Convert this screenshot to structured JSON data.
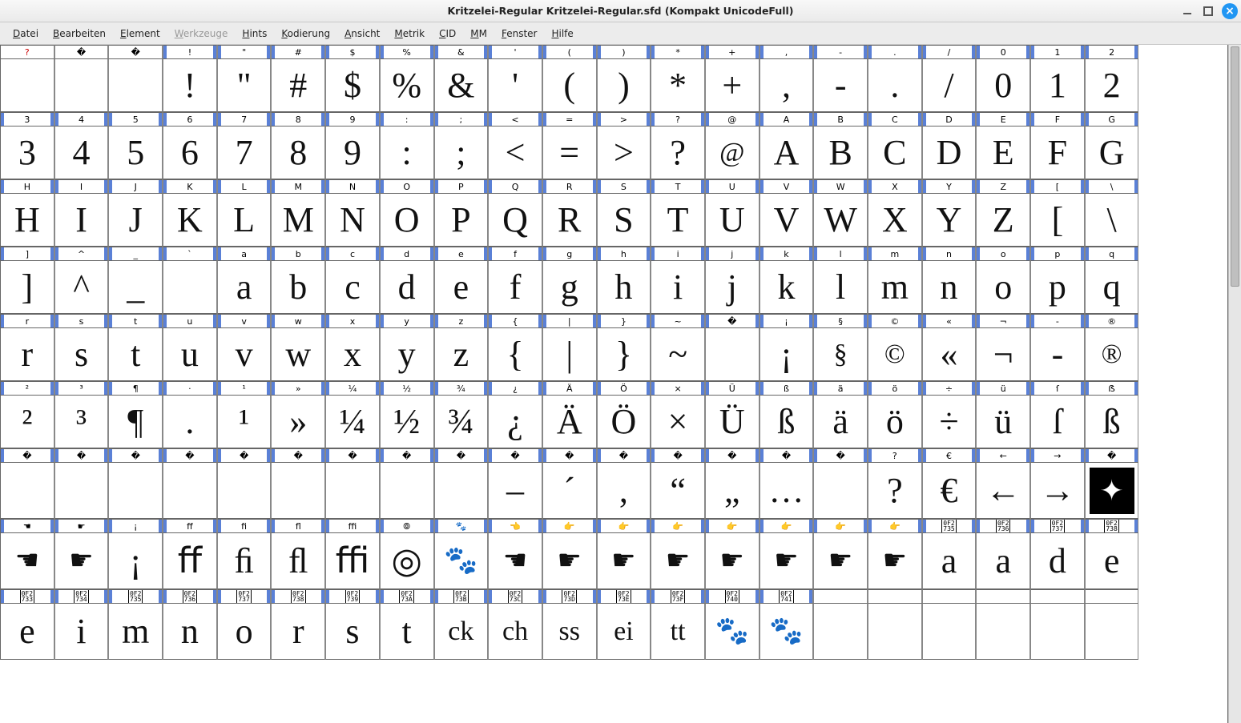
{
  "window": {
    "title": "Kritzelei-Regular  Kritzelei-Regular.sfd (Kompakt UnicodeFull)"
  },
  "menu": [
    {
      "label": "Datei",
      "hot": "D",
      "enabled": true
    },
    {
      "label": "Bearbeiten",
      "hot": "B",
      "enabled": true
    },
    {
      "label": "Element",
      "hot": "E",
      "enabled": true
    },
    {
      "label": "Werkzeuge",
      "hot": "W",
      "enabled": false
    },
    {
      "label": "Hints",
      "hot": "H",
      "enabled": true
    },
    {
      "label": "Kodierung",
      "hot": "K",
      "enabled": true
    },
    {
      "label": "Ansicht",
      "hot": "A",
      "enabled": true
    },
    {
      "label": "Metrik",
      "hot": "M",
      "enabled": true
    },
    {
      "label": "CID",
      "hot": "C",
      "enabled": true
    },
    {
      "label": "MM",
      "hot": "M",
      "enabled": true
    },
    {
      "label": "Fenster",
      "hot": "F",
      "enabled": true
    },
    {
      "label": "Hilfe",
      "hot": "H",
      "enabled": true
    }
  ],
  "rows": [
    {
      "header": [
        "?",
        "�",
        "�",
        "!",
        "\"",
        "#",
        "$",
        "%",
        "&",
        "'",
        "(",
        ")",
        "*",
        "+",
        ",",
        "-",
        ".",
        "/",
        "0",
        "1",
        "2"
      ],
      "flags": [
        "r",
        "",
        "",
        "h",
        "h",
        "h",
        "h",
        "h",
        "h",
        "h",
        "h",
        "h",
        "h",
        "h",
        "h",
        "h",
        "h",
        "h",
        "h",
        "h",
        "h"
      ],
      "glyphs": [
        "",
        "",
        "",
        "!",
        "\"",
        "#",
        "$",
        "%",
        "&",
        "'",
        "(",
        ")",
        "*",
        "+",
        ",",
        "-",
        ".",
        "/",
        "0",
        "1",
        "2"
      ]
    },
    {
      "header": [
        "3",
        "4",
        "5",
        "6",
        "7",
        "8",
        "9",
        ":",
        ";",
        "<",
        "=",
        ">",
        "?",
        "@",
        "A",
        "B",
        "C",
        "D",
        "E",
        "F",
        "G"
      ],
      "flags": [
        "h",
        "h",
        "h",
        "h",
        "h",
        "h",
        "h",
        "h",
        "h",
        "h",
        "h",
        "h",
        "h",
        "h",
        "h",
        "h",
        "h",
        "h",
        "h",
        "h",
        "h"
      ],
      "glyphs": [
        "3",
        "4",
        "5",
        "6",
        "7",
        "8",
        "9",
        ":",
        ";",
        "<",
        "=",
        ">",
        "?",
        "@",
        "A",
        "B",
        "C",
        "D",
        "E",
        "F",
        "G"
      ]
    },
    {
      "header": [
        "H",
        "I",
        "J",
        "K",
        "L",
        "M",
        "N",
        "O",
        "P",
        "Q",
        "R",
        "S",
        "T",
        "U",
        "V",
        "W",
        "X",
        "Y",
        "Z",
        "[",
        "\\"
      ],
      "flags": [
        "h",
        "h",
        "h",
        "h",
        "h",
        "h",
        "h",
        "h",
        "h",
        "h",
        "h",
        "h",
        "h",
        "h",
        "h",
        "h",
        "h",
        "h",
        "h",
        "h",
        "h"
      ],
      "glyphs": [
        "H",
        "I",
        "J",
        "K",
        "L",
        "M",
        "N",
        "O",
        "P",
        "Q",
        "R",
        "S",
        "T",
        "U",
        "V",
        "W",
        "X",
        "Y",
        "Z",
        "[",
        "\\"
      ]
    },
    {
      "header": [
        "]",
        "^",
        "_",
        "`",
        "a",
        "b",
        "c",
        "d",
        "e",
        "f",
        "g",
        "h",
        "i",
        "j",
        "k",
        "l",
        "m",
        "n",
        "o",
        "p",
        "q"
      ],
      "flags": [
        "h",
        "h",
        "h",
        "h",
        "h",
        "h",
        "h",
        "h",
        "h",
        "h",
        "h",
        "h",
        "h",
        "h",
        "h",
        "h",
        "h",
        "h",
        "h",
        "h",
        "h"
      ],
      "glyphs": [
        "]",
        "^",
        "_",
        "",
        "a",
        "b",
        "c",
        "d",
        "e",
        "f",
        "g",
        "h",
        "i",
        "j",
        "k",
        "l",
        "m",
        "n",
        "o",
        "p",
        "q"
      ]
    },
    {
      "header": [
        "r",
        "s",
        "t",
        "u",
        "v",
        "w",
        "x",
        "y",
        "z",
        "{",
        "|",
        "}",
        "~",
        "�",
        "¡",
        "§",
        "©",
        "«",
        "¬",
        "‑",
        "®"
      ],
      "flags": [
        "h",
        "h",
        "h",
        "h",
        "h",
        "h",
        "h",
        "h",
        "h",
        "h",
        "h",
        "h",
        "h",
        "h",
        "h",
        "h",
        "h",
        "h",
        "h",
        "h",
        "h"
      ],
      "glyphs": [
        "r",
        "s",
        "t",
        "u",
        "v",
        "w",
        "x",
        "y",
        "z",
        "{",
        "|",
        "}",
        "~",
        "",
        "¡",
        "§",
        "©",
        "«",
        "¬",
        "-",
        "®"
      ]
    },
    {
      "header": [
        "²",
        "³",
        "¶",
        "·",
        "¹",
        "»",
        "¼",
        "½",
        "¾",
        "¿",
        "Ä",
        "Ö",
        "×",
        "Ü",
        "ß",
        "ä",
        "ö",
        "÷",
        "ü",
        "ſ",
        "ẞ"
      ],
      "flags": [
        "h",
        "h",
        "h",
        "h",
        "h",
        "h",
        "h",
        "h",
        "h",
        "h",
        "h",
        "h",
        "h",
        "h",
        "h",
        "h",
        "h",
        "h",
        "h",
        "h",
        "h"
      ],
      "glyphs": [
        "²",
        "³",
        "¶",
        ".",
        "¹",
        "»",
        "¼",
        "½",
        "¾",
        "¿",
        "Ä",
        "Ö",
        "×",
        "Ü",
        "ß",
        "ä",
        "ö",
        "÷",
        "ü",
        "ſ",
        "ß"
      ]
    },
    {
      "header": [
        "�",
        "�",
        "�",
        "�",
        "�",
        "�",
        "�",
        "�",
        "�",
        "�",
        "�",
        "�",
        "�",
        "�",
        "�",
        "�",
        "?",
        "€",
        "←",
        "→",
        "�"
      ],
      "flags": [
        "h",
        "h",
        "h",
        "h",
        "h",
        "h",
        "h",
        "h",
        "h",
        "h",
        "h",
        "h",
        "h",
        "h",
        "h",
        "h",
        "h",
        "h",
        "h",
        "h",
        "h"
      ],
      "glyphs": [
        "",
        "",
        "",
        "",
        "",
        "",
        "",
        "",
        "",
        "–",
        "´",
        ",",
        "“",
        "„",
        "…",
        "",
        "?",
        "€",
        "←",
        "→",
        "✦"
      ]
    },
    {
      "header": [
        "☚",
        "☛",
        "¡",
        "ﬀ",
        "ﬁ",
        "ﬂ",
        "ﬃ",
        "⦾",
        "🐾",
        "👈",
        "👉",
        "👉",
        "👉",
        "👉",
        "👉",
        "👉",
        "👉",
        "▯",
        "▯",
        "▯",
        "▯"
      ],
      "flags": [
        "h",
        "h",
        "h",
        "h",
        "h",
        "h",
        "h",
        "h",
        "h",
        "h",
        "h",
        "h",
        "h",
        "h",
        "h",
        "h",
        "h",
        "h",
        "h",
        "h",
        "h"
      ],
      "glyphs": [
        "☚",
        "☛",
        "¡",
        "ﬀ",
        "ﬁ",
        "ﬂ",
        "ﬃ",
        "◎",
        "🐾",
        "☚",
        "☛",
        "☛",
        "☛",
        "☛",
        "☛",
        "☛",
        "☛",
        "a",
        "a",
        "d",
        "e"
      ]
    },
    {
      "header": [
        "▯",
        "▯",
        "▯",
        "▯",
        "▯",
        "▯",
        "▯",
        "▯",
        "▯",
        "▯",
        "▯",
        "▯",
        "▯",
        "▯",
        "▯",
        "",
        "",
        "",
        "",
        "",
        ""
      ],
      "flags": [
        "h",
        "h",
        "h",
        "h",
        "h",
        "h",
        "h",
        "h",
        "h",
        "h",
        "h",
        "h",
        "h",
        "h",
        "h",
        "",
        "",
        "",
        "",
        "",
        ""
      ],
      "glyphs": [
        "e",
        "i",
        "m",
        "n",
        "o",
        "r",
        "s",
        "t",
        "ck",
        "ch",
        "ss",
        "ei",
        "tt",
        "🐾",
        "🐾",
        "",
        "",
        "",
        "",
        "",
        ""
      ]
    }
  ],
  "boxcodes": {
    "7": {
      "17": "0F2\n735",
      "18": "0F2\n736",
      "19": "0F2\n737",
      "20": "0F2\n738"
    },
    "8": {
      "0": "0F2\n733",
      "1": "0F2\n734",
      "2": "0F2\n735",
      "3": "0F2\n736",
      "4": "0F2\n737",
      "5": "0F2\n738",
      "6": "0F2\n739",
      "7": "0F2\n73A",
      "8": "0F2\n73B",
      "9": "0F2\n73C",
      "10": "0F2\n73D",
      "11": "0F2\n73E",
      "12": "0F2\n73F",
      "13": "0F2\n740",
      "14": "0F2\n741"
    }
  }
}
